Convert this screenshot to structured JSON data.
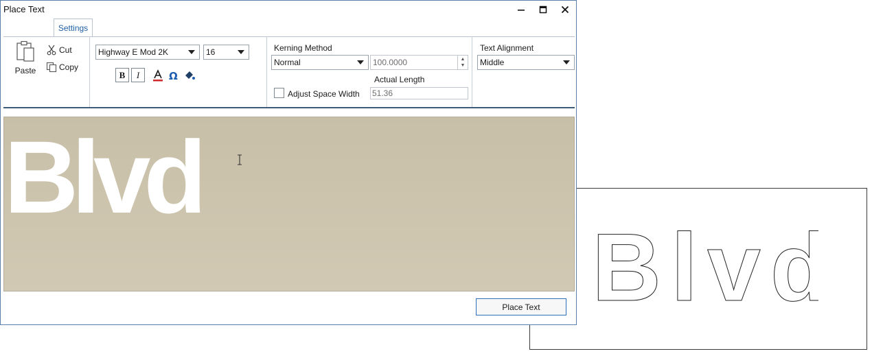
{
  "window": {
    "title": "Place Text",
    "minimize_icon": "minimize-icon",
    "maximize_icon": "maximize-icon",
    "close_icon": "close-icon"
  },
  "tabs": [
    {
      "label": "Settings",
      "active": true
    }
  ],
  "clipboard": {
    "paste_label": "Paste",
    "cut_label": "Cut",
    "copy_label": "Copy"
  },
  "font": {
    "family": "Highway E Mod 2K",
    "size": "16",
    "bold_label": "B",
    "italic_label": "I",
    "color_icon": "font-color-icon",
    "symbol_icon": "omega-symbol-icon",
    "fill_icon": "fill-bucket-icon",
    "accent_red": "#d12a2a",
    "accent_blue": "#2060b0"
  },
  "kerning": {
    "label": "Kerning Method",
    "method": "Normal",
    "value": "100.0000",
    "actual_length_label": "Actual Length",
    "actual_length": "51.36",
    "adjust_space_label": "Adjust Space Width",
    "adjust_space_checked": false
  },
  "alignment": {
    "label": "Text Alignment",
    "value": "Middle"
  },
  "preview": {
    "text": "Blvd",
    "background": "#cdc5ae"
  },
  "actions": {
    "place_label": "Place Text"
  },
  "drawing": {
    "outline_text": "Blvd"
  }
}
